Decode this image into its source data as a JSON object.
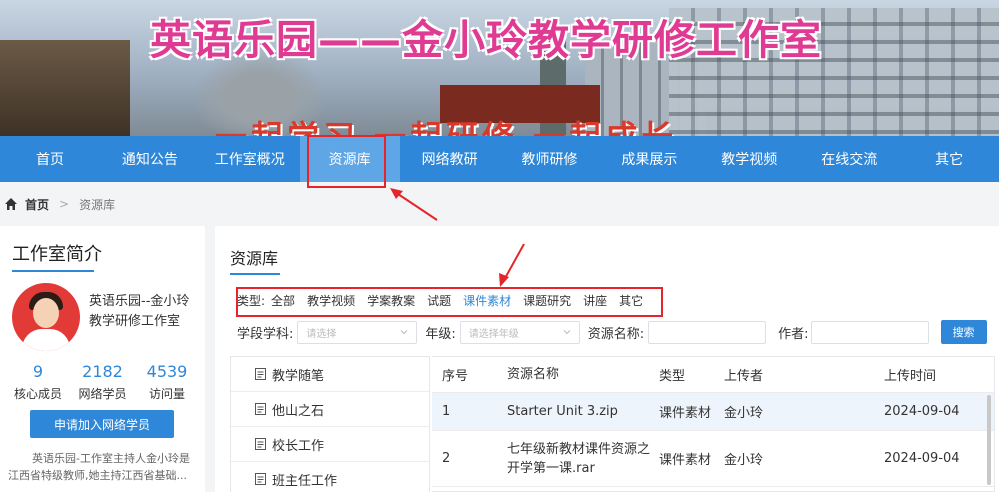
{
  "banner": {
    "title": "英语乐园——金小玲教学研修工作室",
    "slogan": "一起学习 一起研修 一起成长"
  },
  "nav": {
    "items": [
      "首页",
      "通知公告",
      "工作室概况",
      "资源库",
      "网络教研",
      "教师研修",
      "成果展示",
      "教学视频",
      "在线交流",
      "其它"
    ],
    "active_index": 3
  },
  "breadcrumb": {
    "home": "首页",
    "current": "资源库"
  },
  "studio": {
    "heading": "工作室简介",
    "name": "英语乐园--金小玲教学研修工作室",
    "stats": [
      {
        "value": "9",
        "label": "核心成员"
      },
      {
        "value": "2182",
        "label": "网络学员"
      },
      {
        "value": "4539",
        "label": "访问量"
      }
    ],
    "join_button": "申请加入网络学员",
    "intro": "英语乐园-工作室主持人金小玲是江西省特级教师,她主持江西省基础..."
  },
  "resources": {
    "heading": "资源库",
    "type_label": "类型:",
    "types": [
      "全部",
      "教学视频",
      "学案教案",
      "试题",
      "课件素材",
      "课题研究",
      "讲座",
      "其它"
    ],
    "active_type_index": 4,
    "filters": {
      "subject_label": "学段学科:",
      "subject_placeholder": "请选择",
      "grade_label": "年级:",
      "grade_placeholder": "请选择年级",
      "name_label": "资源名称:",
      "author_label": "作者:",
      "search_button": "搜索"
    },
    "categories": [
      "教学随笔",
      "他山之石",
      "校长工作",
      "班主任工作"
    ],
    "table": {
      "headers": [
        "序号",
        "资源名称",
        "类型",
        "上传者",
        "上传时间"
      ],
      "rows": [
        {
          "no": "1",
          "name": "Starter Unit 3.zip",
          "type": "课件素材",
          "uploader": "金小玲",
          "date": "2024-09-04"
        },
        {
          "no": "2",
          "name": "七年级新教材课件资源之开学第一课.rar",
          "type": "课件素材",
          "uploader": "金小玲",
          "date": "2024-09-04"
        }
      ]
    }
  },
  "colors": {
    "primary": "#2e87d8",
    "highlight": "#e5252b",
    "title_pink": "#e03b93"
  }
}
